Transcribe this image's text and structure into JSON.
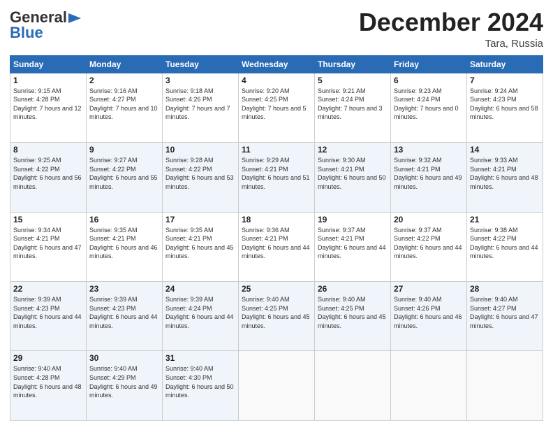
{
  "header": {
    "logo_general": "General",
    "logo_blue": "Blue",
    "month_title": "December 2024",
    "location": "Tara, Russia"
  },
  "weekdays": [
    "Sunday",
    "Monday",
    "Tuesday",
    "Wednesday",
    "Thursday",
    "Friday",
    "Saturday"
  ],
  "weeks": [
    [
      {
        "day": "1",
        "sunrise": "Sunrise: 9:15 AM",
        "sunset": "Sunset: 4:28 PM",
        "daylight": "Daylight: 7 hours and 12 minutes."
      },
      {
        "day": "2",
        "sunrise": "Sunrise: 9:16 AM",
        "sunset": "Sunset: 4:27 PM",
        "daylight": "Daylight: 7 hours and 10 minutes."
      },
      {
        "day": "3",
        "sunrise": "Sunrise: 9:18 AM",
        "sunset": "Sunset: 4:26 PM",
        "daylight": "Daylight: 7 hours and 7 minutes."
      },
      {
        "day": "4",
        "sunrise": "Sunrise: 9:20 AM",
        "sunset": "Sunset: 4:25 PM",
        "daylight": "Daylight: 7 hours and 5 minutes."
      },
      {
        "day": "5",
        "sunrise": "Sunrise: 9:21 AM",
        "sunset": "Sunset: 4:24 PM",
        "daylight": "Daylight: 7 hours and 3 minutes."
      },
      {
        "day": "6",
        "sunrise": "Sunrise: 9:23 AM",
        "sunset": "Sunset: 4:24 PM",
        "daylight": "Daylight: 7 hours and 0 minutes."
      },
      {
        "day": "7",
        "sunrise": "Sunrise: 9:24 AM",
        "sunset": "Sunset: 4:23 PM",
        "daylight": "Daylight: 6 hours and 58 minutes."
      }
    ],
    [
      {
        "day": "8",
        "sunrise": "Sunrise: 9:25 AM",
        "sunset": "Sunset: 4:22 PM",
        "daylight": "Daylight: 6 hours and 56 minutes."
      },
      {
        "day": "9",
        "sunrise": "Sunrise: 9:27 AM",
        "sunset": "Sunset: 4:22 PM",
        "daylight": "Daylight: 6 hours and 55 minutes."
      },
      {
        "day": "10",
        "sunrise": "Sunrise: 9:28 AM",
        "sunset": "Sunset: 4:22 PM",
        "daylight": "Daylight: 6 hours and 53 minutes."
      },
      {
        "day": "11",
        "sunrise": "Sunrise: 9:29 AM",
        "sunset": "Sunset: 4:21 PM",
        "daylight": "Daylight: 6 hours and 51 minutes."
      },
      {
        "day": "12",
        "sunrise": "Sunrise: 9:30 AM",
        "sunset": "Sunset: 4:21 PM",
        "daylight": "Daylight: 6 hours and 50 minutes."
      },
      {
        "day": "13",
        "sunrise": "Sunrise: 9:32 AM",
        "sunset": "Sunset: 4:21 PM",
        "daylight": "Daylight: 6 hours and 49 minutes."
      },
      {
        "day": "14",
        "sunrise": "Sunrise: 9:33 AM",
        "sunset": "Sunset: 4:21 PM",
        "daylight": "Daylight: 6 hours and 48 minutes."
      }
    ],
    [
      {
        "day": "15",
        "sunrise": "Sunrise: 9:34 AM",
        "sunset": "Sunset: 4:21 PM",
        "daylight": "Daylight: 6 hours and 47 minutes."
      },
      {
        "day": "16",
        "sunrise": "Sunrise: 9:35 AM",
        "sunset": "Sunset: 4:21 PM",
        "daylight": "Daylight: 6 hours and 46 minutes."
      },
      {
        "day": "17",
        "sunrise": "Sunrise: 9:35 AM",
        "sunset": "Sunset: 4:21 PM",
        "daylight": "Daylight: 6 hours and 45 minutes."
      },
      {
        "day": "18",
        "sunrise": "Sunrise: 9:36 AM",
        "sunset": "Sunset: 4:21 PM",
        "daylight": "Daylight: 6 hours and 44 minutes."
      },
      {
        "day": "19",
        "sunrise": "Sunrise: 9:37 AM",
        "sunset": "Sunset: 4:21 PM",
        "daylight": "Daylight: 6 hours and 44 minutes."
      },
      {
        "day": "20",
        "sunrise": "Sunrise: 9:37 AM",
        "sunset": "Sunset: 4:22 PM",
        "daylight": "Daylight: 6 hours and 44 minutes."
      },
      {
        "day": "21",
        "sunrise": "Sunrise: 9:38 AM",
        "sunset": "Sunset: 4:22 PM",
        "daylight": "Daylight: 6 hours and 44 minutes."
      }
    ],
    [
      {
        "day": "22",
        "sunrise": "Sunrise: 9:39 AM",
        "sunset": "Sunset: 4:23 PM",
        "daylight": "Daylight: 6 hours and 44 minutes."
      },
      {
        "day": "23",
        "sunrise": "Sunrise: 9:39 AM",
        "sunset": "Sunset: 4:23 PM",
        "daylight": "Daylight: 6 hours and 44 minutes."
      },
      {
        "day": "24",
        "sunrise": "Sunrise: 9:39 AM",
        "sunset": "Sunset: 4:24 PM",
        "daylight": "Daylight: 6 hours and 44 minutes."
      },
      {
        "day": "25",
        "sunrise": "Sunrise: 9:40 AM",
        "sunset": "Sunset: 4:25 PM",
        "daylight": "Daylight: 6 hours and 45 minutes."
      },
      {
        "day": "26",
        "sunrise": "Sunrise: 9:40 AM",
        "sunset": "Sunset: 4:25 PM",
        "daylight": "Daylight: 6 hours and 45 minutes."
      },
      {
        "day": "27",
        "sunrise": "Sunrise: 9:40 AM",
        "sunset": "Sunset: 4:26 PM",
        "daylight": "Daylight: 6 hours and 46 minutes."
      },
      {
        "day": "28",
        "sunrise": "Sunrise: 9:40 AM",
        "sunset": "Sunset: 4:27 PM",
        "daylight": "Daylight: 6 hours and 47 minutes."
      }
    ],
    [
      {
        "day": "29",
        "sunrise": "Sunrise: 9:40 AM",
        "sunset": "Sunset: 4:28 PM",
        "daylight": "Daylight: 6 hours and 48 minutes."
      },
      {
        "day": "30",
        "sunrise": "Sunrise: 9:40 AM",
        "sunset": "Sunset: 4:29 PM",
        "daylight": "Daylight: 6 hours and 49 minutes."
      },
      {
        "day": "31",
        "sunrise": "Sunrise: 9:40 AM",
        "sunset": "Sunset: 4:30 PM",
        "daylight": "Daylight: 6 hours and 50 minutes."
      },
      null,
      null,
      null,
      null
    ]
  ]
}
